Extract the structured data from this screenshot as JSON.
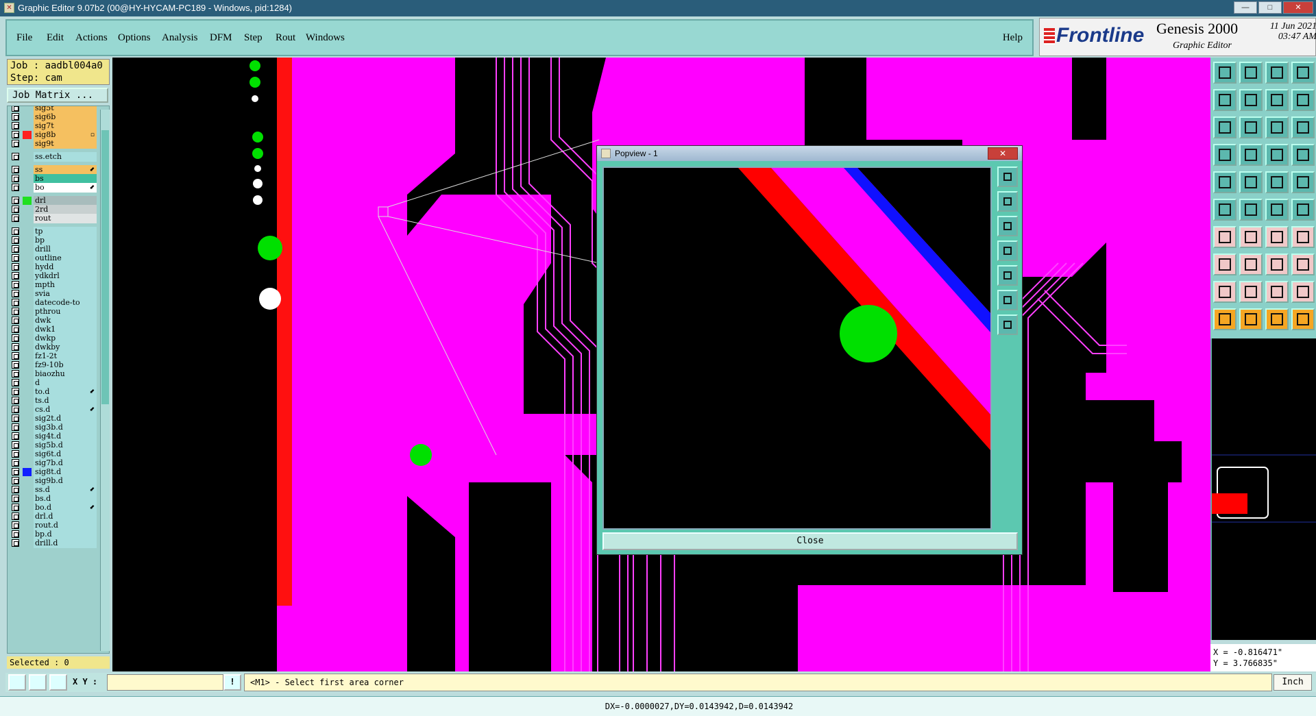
{
  "window": {
    "title": "Graphic Editor 9.07b2 (00@HY-HYCAM-PC189 - Windows, pid:1284)",
    "min": "—",
    "max": "□",
    "close": "✕"
  },
  "menu": [
    "File",
    "Edit",
    "Actions",
    "Options",
    "Analysis",
    "DFM",
    "Step",
    "Rout",
    "Windows"
  ],
  "help_label": "Help",
  "brand": {
    "logo": "Frontline",
    "product": "Genesis 2000",
    "subtitle": "Graphic Editor",
    "date": "11 Jun 2021",
    "time": "03:47 AM"
  },
  "job": {
    "job_line": "Job : aadbl004a0",
    "step_line": "Step: cam",
    "matrix_button": "Job Matrix ..."
  },
  "colors": {
    "magenta": "#ff00ff",
    "green": "#00e000",
    "red": "#ff0000",
    "blue": "#1010ff",
    "yellow": "#f5c060",
    "teal": "#40c0a0",
    "lightblue": "#a8dede",
    "gray": "#c8d0d0",
    "panel": "#9ed0cc"
  },
  "layers": [
    {
      "name": "sig5t",
      "bg": "#f5c060",
      "sw": ""
    },
    {
      "name": "sig6b",
      "bg": "#f5c060",
      "sw": ""
    },
    {
      "name": "sig7t",
      "bg": "#f5c060",
      "sw": ""
    },
    {
      "name": "sig8b",
      "bg": "#f5c060",
      "sw": "#ff2020",
      "mark": "▫",
      "active": true
    },
    {
      "name": "sig9t",
      "bg": "#f5c060",
      "sw": ""
    },
    {
      "name": "ss.etch",
      "bg": "#a8dede",
      "sw": "",
      "gap": true
    },
    {
      "name": "ss",
      "bg": "#f5c060",
      "sw": "",
      "mark": "⬋",
      "gap": true
    },
    {
      "name": "bs",
      "bg": "#40c0a0",
      "sw": ""
    },
    {
      "name": "bo",
      "bg": "#ffffff",
      "sw": "",
      "mark": "⬋"
    },
    {
      "name": "drl",
      "bg": "#a8bcbc",
      "sw": "#20e020",
      "gap": true
    },
    {
      "name": "2rd",
      "bg": "#c8d0d0",
      "sw": ""
    },
    {
      "name": "rout",
      "bg": "#e0e4e4",
      "sw": ""
    },
    {
      "name": "tp",
      "bg": "#a8dede",
      "sw": "",
      "gap": true
    },
    {
      "name": "bp",
      "bg": "#a8dede",
      "sw": ""
    },
    {
      "name": "drill",
      "bg": "#a8dede",
      "sw": ""
    },
    {
      "name": "outline",
      "bg": "#a8dede",
      "sw": ""
    },
    {
      "name": "hydd",
      "bg": "#a8dede",
      "sw": ""
    },
    {
      "name": "ydkdrl",
      "bg": "#a8dede",
      "sw": ""
    },
    {
      "name": "mpth",
      "bg": "#a8dede",
      "sw": ""
    },
    {
      "name": "svia",
      "bg": "#a8dede",
      "sw": ""
    },
    {
      "name": "datecode-to",
      "bg": "#a8dede",
      "sw": ""
    },
    {
      "name": "pthrou",
      "bg": "#a8dede",
      "sw": ""
    },
    {
      "name": "dwk",
      "bg": "#a8dede",
      "sw": ""
    },
    {
      "name": "dwk1",
      "bg": "#a8dede",
      "sw": ""
    },
    {
      "name": "dwkp",
      "bg": "#a8dede",
      "sw": ""
    },
    {
      "name": "dwkby",
      "bg": "#a8dede",
      "sw": ""
    },
    {
      "name": "fz1-2t",
      "bg": "#a8dede",
      "sw": ""
    },
    {
      "name": "fz9-10b",
      "bg": "#a8dede",
      "sw": ""
    },
    {
      "name": "biaozhu",
      "bg": "#a8dede",
      "sw": ""
    },
    {
      "name": "d",
      "bg": "#a8dede",
      "sw": ""
    },
    {
      "name": "to.d",
      "bg": "#a8dede",
      "sw": "",
      "mark": "⬋"
    },
    {
      "name": "ts.d",
      "bg": "#a8dede",
      "sw": ""
    },
    {
      "name": "cs.d",
      "bg": "#a8dede",
      "sw": "",
      "mark": "⬋"
    },
    {
      "name": "sig2t.d",
      "bg": "#a8dede",
      "sw": ""
    },
    {
      "name": "sig3b.d",
      "bg": "#a8dede",
      "sw": ""
    },
    {
      "name": "sig4t.d",
      "bg": "#a8dede",
      "sw": ""
    },
    {
      "name": "sig5b.d",
      "bg": "#a8dede",
      "sw": ""
    },
    {
      "name": "sig6t.d",
      "bg": "#a8dede",
      "sw": ""
    },
    {
      "name": "sig7b.d",
      "bg": "#a8dede",
      "sw": ""
    },
    {
      "name": "sig8t.d",
      "bg": "#a8dede",
      "sw": "#1020ff"
    },
    {
      "name": "sig9b.d",
      "bg": "#a8dede",
      "sw": ""
    },
    {
      "name": "ss.d",
      "bg": "#a8dede",
      "sw": "",
      "mark": "⬋"
    },
    {
      "name": "bs.d",
      "bg": "#a8dede",
      "sw": ""
    },
    {
      "name": "bo.d",
      "bg": "#a8dede",
      "sw": "",
      "mark": "⬋"
    },
    {
      "name": "drl.d",
      "bg": "#a8dede",
      "sw": ""
    },
    {
      "name": "rout.d",
      "bg": "#a8dede",
      "sw": ""
    },
    {
      "name": "bp.d",
      "bg": "#a8dede",
      "sw": ""
    },
    {
      "name": "drill.d",
      "bg": "#a8dede",
      "sw": ""
    }
  ],
  "selected": "Selected : 0",
  "popview": {
    "title": "Popview - 1",
    "close_label": "Close"
  },
  "bottom": {
    "xy_label": "X Y :",
    "xy_value": "",
    "prompt": "<M1> - Select first area corner",
    "units": "Inch"
  },
  "coords": {
    "x": "X = -0.816471\"",
    "y": "Y = 3.766835\""
  },
  "status": "DX=-0.0000027,DY=0.0143942,D=0.0143942"
}
